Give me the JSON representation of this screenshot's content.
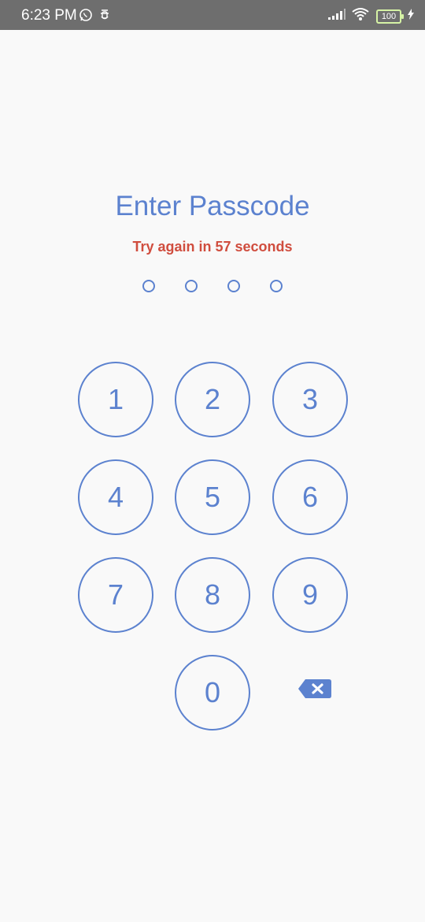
{
  "status_bar": {
    "time": "6:23 PM",
    "battery": "100"
  },
  "lock": {
    "title": "Enter Passcode",
    "message": "Try again in 57 seconds",
    "dots_count": 4
  },
  "keypad": {
    "k1": "1",
    "k2": "2",
    "k3": "3",
    "k4": "4",
    "k5": "5",
    "k6": "6",
    "k7": "7",
    "k8": "8",
    "k9": "9",
    "k0": "0"
  },
  "icons": {
    "backspace": "backspace-icon"
  },
  "colors": {
    "accent": "#5c82cf",
    "error": "#d04d3e",
    "background": "#f9f9f9"
  }
}
